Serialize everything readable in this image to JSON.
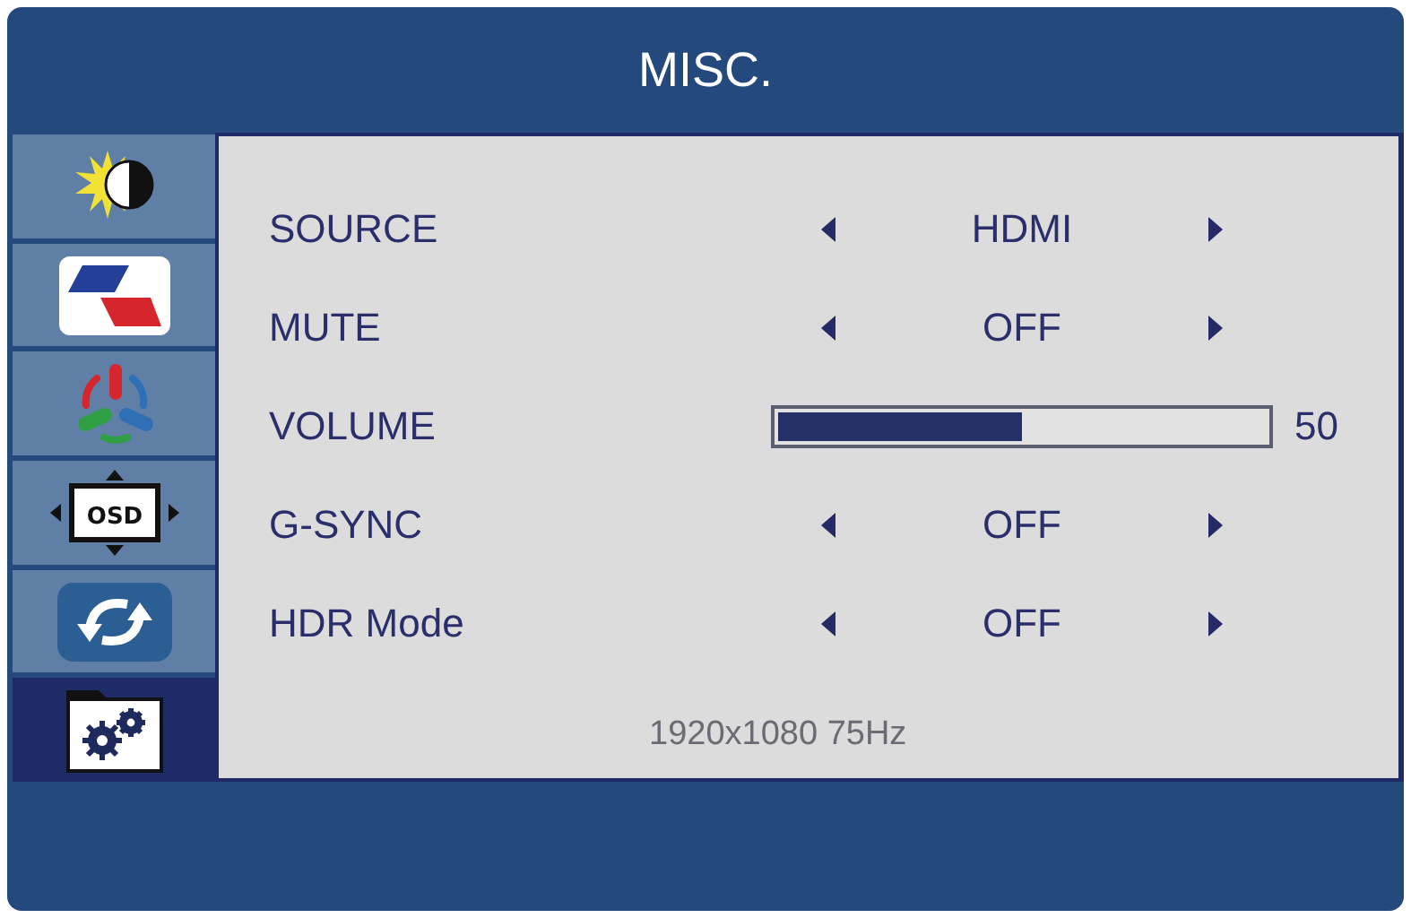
{
  "window": {
    "title": "MISC."
  },
  "menu_tabs": [
    {
      "kind": "brightness",
      "selected": false
    },
    {
      "kind": "image",
      "selected": false
    },
    {
      "kind": "color",
      "selected": false
    },
    {
      "kind": "osd",
      "label": "OSD",
      "selected": false
    },
    {
      "kind": "reset",
      "selected": false
    },
    {
      "kind": "misc",
      "selected": true
    }
  ],
  "settings": [
    {
      "kind": "select",
      "label": "SOURCE",
      "value": "HDMI"
    },
    {
      "kind": "select",
      "label": "MUTE",
      "value": "OFF"
    },
    {
      "kind": "slider",
      "label": "VOLUME",
      "level": 0.5,
      "reading": "50"
    },
    {
      "kind": "select",
      "label": "G-SYNC",
      "value": "OFF"
    },
    {
      "kind": "select",
      "label": "HDR Mode",
      "value": "OFF"
    }
  ],
  "info": "1920x1080 75Hz"
}
